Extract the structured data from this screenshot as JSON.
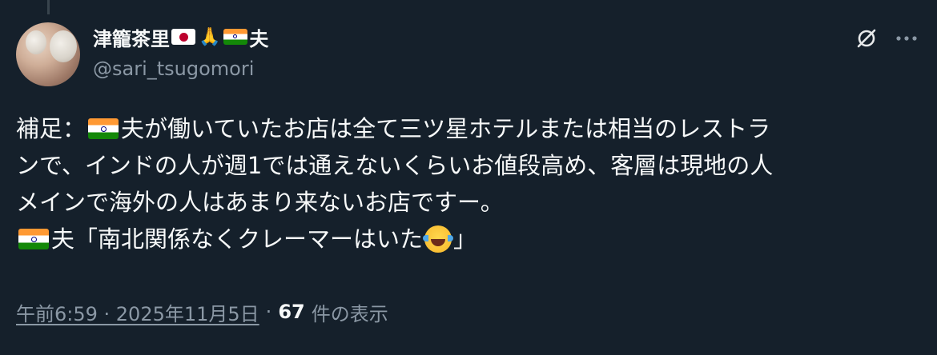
{
  "author": {
    "display_name_text": "津籠茶里",
    "display_name_suffix": "夫",
    "handle": "@sari_tsugomori"
  },
  "icons": {
    "flag_japan": "flag-japan-icon",
    "flag_india": "flag-india-icon",
    "folded_hands": "folded-hands-icon",
    "grok": "grok-icon",
    "more": "more-icon",
    "laughing_tears": "laughing-tears-icon"
  },
  "tweet": {
    "line1_prefix": "補足：",
    "line1_text": "夫が働いていたお店は全て三ツ星ホテルまたは相当のレストラ",
    "line2_text": "ンで、インドの人が週1では通えないくらいお値段高め、客層は現地の人",
    "line3_text": "メインで海外の人はあまり来ないお店ですー。",
    "line4_text": "夫「南北関係なくクレーマーはいた",
    "line4_end": "」"
  },
  "meta": {
    "timestamp": "午前6:59 · 2025年11月5日",
    "separator": "·",
    "views_count": "67",
    "views_label": "件の表示"
  },
  "colors": {
    "background": "#15202b",
    "text_primary": "#f7f9f9",
    "text_secondary": "#8b98a5"
  }
}
